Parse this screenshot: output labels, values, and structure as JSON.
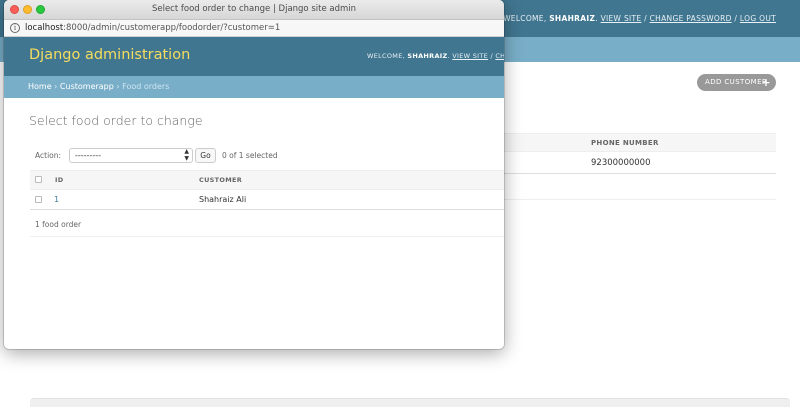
{
  "background": {
    "user_tools": {
      "welcome": "WELCOME,",
      "username": "SHAHRAIZ",
      "view_site": "VIEW SITE",
      "change_password": "CHANGE PASSWORD",
      "log_out": "LOG OUT"
    },
    "add_button_label": "ADD CUSTOMER",
    "add_button_icon": "plus-icon",
    "table": {
      "header_phone": "PHONE NUMBER",
      "row_phone": "92300000000"
    }
  },
  "window": {
    "title": "Select food order to change | Django site admin",
    "url_host": "localhost",
    "url_path": ":8000/admin/customerapp/foodorder/?customer=1",
    "info_icon": "info-icon"
  },
  "header": {
    "branding": "Django administration",
    "user_tools": {
      "welcome": "WELCOME,",
      "username": "SHAHRAIZ",
      "view_site": "VIEW SITE",
      "truncated": "CHAN"
    }
  },
  "breadcrumbs": {
    "home": "Home",
    "app": "Customerapp",
    "current": "Food orders",
    "separator": "›"
  },
  "content": {
    "heading": "Select food order to change",
    "action_label": "Action:",
    "action_selected": "---------",
    "go_label": "Go",
    "selected_counter": "0 of 1 selected",
    "columns": {
      "id": "ID",
      "customer": "CUSTOMER"
    },
    "rows": [
      {
        "id": "1",
        "customer": "Shahraiz Ali"
      }
    ],
    "paginator": "1 food order"
  },
  "colors": {
    "header_bg": "#417690",
    "breadcrumb_bg": "#79aec8",
    "branding": "#f5dd5d",
    "link": "#447e9b"
  }
}
